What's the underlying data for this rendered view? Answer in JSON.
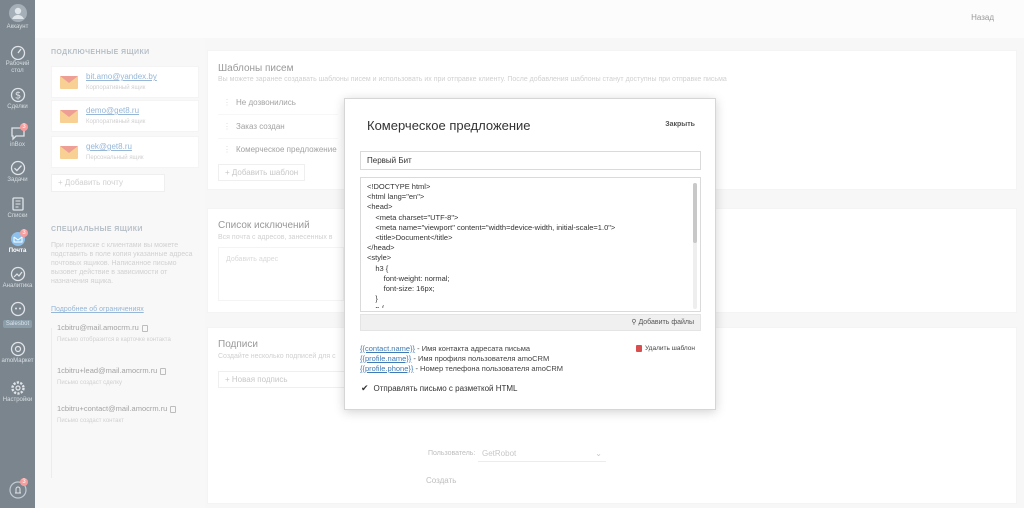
{
  "nav": {
    "account": "Аккаунт",
    "items": [
      {
        "label": "Рабочий стол",
        "icon": "speedometer-icon"
      },
      {
        "label": "Сделки",
        "icon": "dollar-icon"
      },
      {
        "label": "inBox",
        "icon": "chat-icon",
        "badge": "3"
      },
      {
        "label": "Задачи",
        "icon": "check-icon"
      },
      {
        "label": "Списки",
        "icon": "notebook-icon"
      },
      {
        "label": "Почта",
        "icon": "mail-icon",
        "badge": "3"
      },
      {
        "label": "Аналитика",
        "icon": "analytics-icon"
      },
      {
        "label": "Salesbot",
        "icon": "bot-icon"
      },
      {
        "label": "amoМаркет",
        "icon": "market-icon"
      },
      {
        "label": "Настройки",
        "icon": "gear-icon"
      }
    ],
    "bottom_badge": "3"
  },
  "topbar": {
    "back": "Назад"
  },
  "mailboxes": {
    "title": "ПОДКЛЮЧЕННЫЕ ЯЩИКИ",
    "items": [
      {
        "email": "bit.amo@yandex.by",
        "type": "Корпоративный ящик"
      },
      {
        "email": "demo@get8.ru",
        "type": "Корпоративный ящик"
      },
      {
        "email": "gek@get8.ru",
        "type": "Персональный ящик"
      }
    ],
    "add": "+  Добавить почту"
  },
  "special": {
    "title": "СПЕЦИАЛЬНЫЕ ЯЩИКИ",
    "desc": "При переписке с клиентами вы можете подставить в поле копия указанные адреса почтовых ящиков. Написанное письмо вызовет действие в зависимости от назначения ящика.",
    "link": "Подробнее об ограничениях",
    "items": [
      {
        "email": "1cbitru@mail.amocrm.ru",
        "desc": "Письмо отобразится в карточке контакта"
      },
      {
        "email": "1cbitru+lead@mail.amocrm.ru",
        "desc": "Письмо создаст сделку"
      },
      {
        "email": "1cbitru+contact@mail.amocrm.ru",
        "desc": "Письмо создаст контакт"
      }
    ]
  },
  "templates": {
    "title": "Шаблоны писем",
    "desc": "Вы можете заранее создавать шаблоны писем и использовать их при отправке клиенту. После добавления шаблоны станут доступны при отправке письма",
    "items": [
      "Не дозвонились",
      "Заказ создан",
      "Комерческое предложение"
    ],
    "add": "+  Добавить шаблон"
  },
  "exclusions": {
    "title": "Список исключений",
    "desc": "Вся почта с адресов, занесенных в",
    "placeholder": "Добавить адрес"
  },
  "signatures": {
    "title": "Подписи",
    "desc": "Создайте несколько подписей для с",
    "add": "+  Новая подпись",
    "user_label": "Пользователь:",
    "user_value": "GetRobot",
    "create": "Создать"
  },
  "modal": {
    "title": "Комерческое предложение",
    "close": "Закрыть",
    "name_value": "Первый Бит",
    "code_lines": [
      "<!DOCTYPE html>",
      "<html lang=\"en\">",
      "<head>",
      "    <meta charset=\"UTF-8\">",
      "    <meta name=\"viewport\" content=\"width=device-width, initial-scale=1.0\">",
      "    <title>Document</title>",
      "</head>",
      "<style>",
      "    h3 {",
      "        font-weight: normal;",
      "        font-size: 16px;",
      "    }",
      "    p {"
    ],
    "attach": "Добавить файлы",
    "vars": [
      {
        "key": "{{contact.name}}",
        "text": " - Имя контакта адресата письма"
      },
      {
        "key": "{{profile.name}}",
        "text": " - Имя профиля пользователя amoCRM"
      },
      {
        "key": "{{profile.phone}}",
        "text": " - Номер телефона пользователя amoCRM"
      }
    ],
    "delete": "Удалить шаблон",
    "html_checkbox": "Отправлять письмо с разметкой HTML"
  },
  "colors": {
    "nav_bg": "#0f2231",
    "link": "#3e7bb6",
    "accent": "#f04e4e"
  }
}
